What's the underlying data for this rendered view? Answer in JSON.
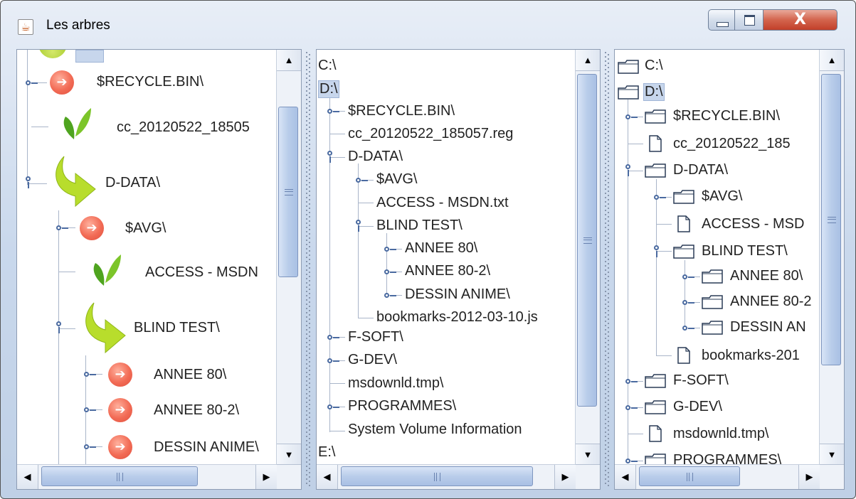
{
  "window": {
    "title": "Les arbres",
    "close_label": "X"
  },
  "pane1": {
    "items": [
      {
        "label": "$RECYCLE.BIN\\"
      },
      {
        "label": "cc_20120522_18505"
      },
      {
        "label": "D-DATA\\"
      },
      {
        "label": "$AVG\\"
      },
      {
        "label": "ACCESS - MSDN"
      },
      {
        "label": "BLIND TEST\\"
      },
      {
        "label": "ANNEE 80\\"
      },
      {
        "label": "ANNEE 80-2\\"
      },
      {
        "label": "DESSIN ANIME\\"
      }
    ]
  },
  "pane2": {
    "items": [
      {
        "label": "C:\\"
      },
      {
        "label": "D:\\"
      },
      {
        "label": "$RECYCLE.BIN\\"
      },
      {
        "label": "cc_20120522_185057.reg"
      },
      {
        "label": "D-DATA\\"
      },
      {
        "label": "$AVG\\"
      },
      {
        "label": "ACCESS - MSDN.txt"
      },
      {
        "label": "BLIND TEST\\"
      },
      {
        "label": "ANNEE 80\\"
      },
      {
        "label": "ANNEE 80-2\\"
      },
      {
        "label": "DESSIN ANIME\\"
      },
      {
        "label": "bookmarks-2012-03-10.js"
      },
      {
        "label": "F-SOFT\\"
      },
      {
        "label": "G-DEV\\"
      },
      {
        "label": "msdownld.tmp\\"
      },
      {
        "label": "PROGRAMMES\\"
      },
      {
        "label": "System Volume Information"
      },
      {
        "label": "E:\\"
      }
    ]
  },
  "pane3": {
    "items": [
      {
        "label": "C:\\"
      },
      {
        "label": "D:\\"
      },
      {
        "label": "$RECYCLE.BIN\\"
      },
      {
        "label": "cc_20120522_185"
      },
      {
        "label": "D-DATA\\"
      },
      {
        "label": "$AVG\\"
      },
      {
        "label": "ACCESS - MSD"
      },
      {
        "label": "BLIND TEST\\"
      },
      {
        "label": "ANNEE 80\\"
      },
      {
        "label": "ANNEE 80-2"
      },
      {
        "label": "DESSIN AN"
      },
      {
        "label": "bookmarks-201"
      },
      {
        "label": "F-SOFT\\"
      },
      {
        "label": "G-DEV\\"
      },
      {
        "label": "msdownld.tmp\\"
      },
      {
        "label": "PROGRAMMES\\"
      }
    ]
  },
  "colors": {
    "selection": "#c7d6ec",
    "tree_line": "#a9b5c9",
    "close_button": "#c2402a"
  }
}
